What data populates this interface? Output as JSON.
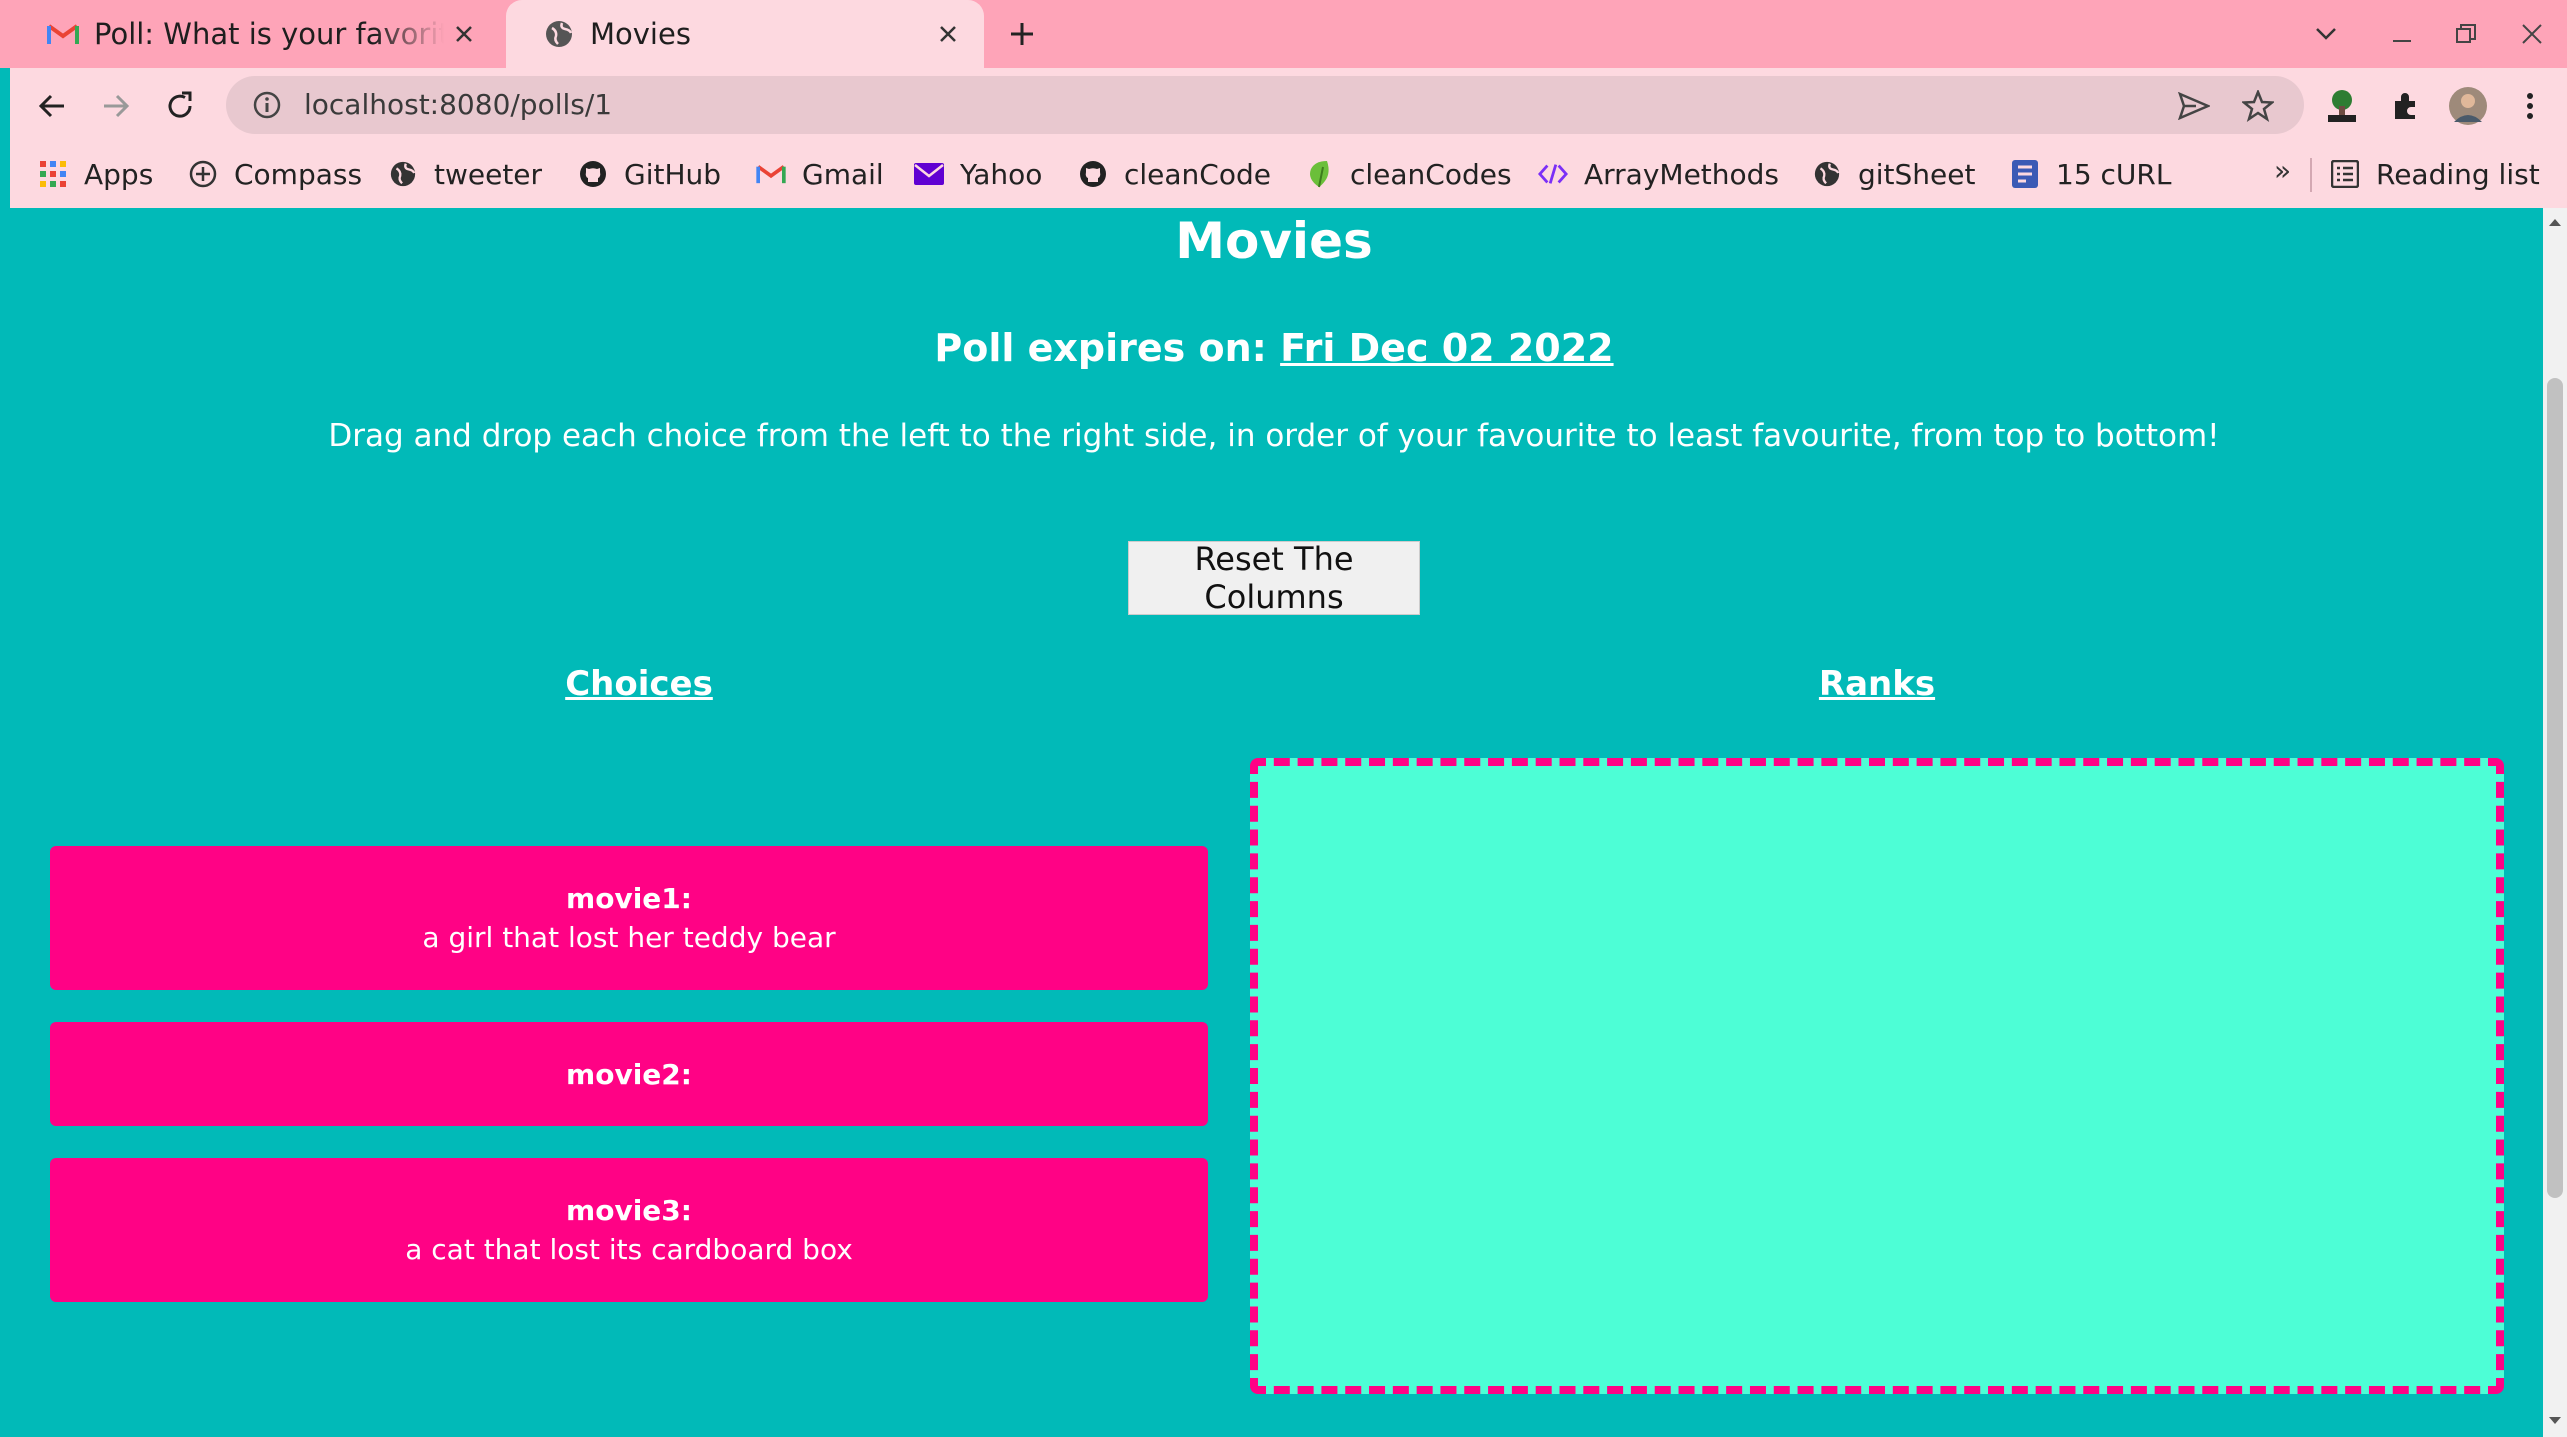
{
  "browser": {
    "tabs": [
      {
        "title": "Poll: What is your favorite",
        "icon": "gmail-icon",
        "active": false
      },
      {
        "title": "Movies",
        "icon": "globe-icon",
        "active": true
      }
    ],
    "url": "localhost:8080/polls/1",
    "bookmarks": [
      {
        "label": "Apps",
        "icon": "apps-grid-icon"
      },
      {
        "label": "Compass",
        "icon": "compass-icon"
      },
      {
        "label": "tweeter",
        "icon": "globe-icon"
      },
      {
        "label": "GitHub",
        "icon": "github-icon"
      },
      {
        "label": "Gmail",
        "icon": "gmail-icon"
      },
      {
        "label": "Yahoo",
        "icon": "yahoo-mail-icon"
      },
      {
        "label": "cleanCode",
        "icon": "github-icon"
      },
      {
        "label": "cleanCodes",
        "icon": "leaf-icon"
      },
      {
        "label": "ArrayMethods",
        "icon": "code-icon"
      },
      {
        "label": "gitSheet",
        "icon": "globe-icon"
      },
      {
        "label": "15 cURL",
        "icon": "document-icon"
      }
    ],
    "more_label": "»",
    "reading_list_label": "Reading list"
  },
  "page": {
    "title": "Movies",
    "expires_label": "Poll expires on:",
    "expires_date": "Fri Dec 02 2022",
    "instructions": "Drag and drop each choice from the left to the right side, in order of your favourite to least favourite, from top to bottom!",
    "reset_label": "Reset The Columns",
    "choices_heading": "Choices",
    "ranks_heading": "Ranks",
    "choices": [
      {
        "name": "movie1:",
        "description": "a girl that lost her teddy bear"
      },
      {
        "name": "movie2:",
        "description": ""
      },
      {
        "name": "movie3:",
        "description": "a cat that lost its cardboard box"
      }
    ]
  },
  "colors": {
    "page_bg": "#01bab8",
    "card_bg": "#ff0285",
    "ranks_bg": "#4dfed6",
    "ranks_border": "#ff0285",
    "chrome_bg": "#fea4b8"
  }
}
